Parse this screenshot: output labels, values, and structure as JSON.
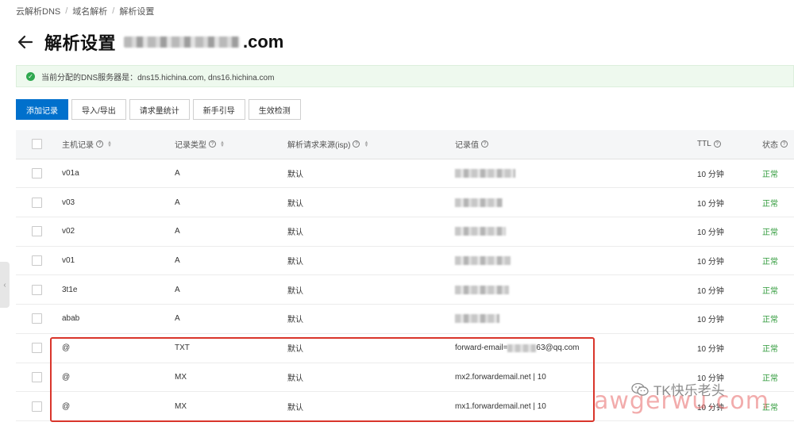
{
  "breadcrumb": [
    "云解析DNS",
    "域名解析",
    "解析设置"
  ],
  "title": {
    "text": "解析设置",
    "domain_suffix": ".com"
  },
  "notice": {
    "text": "当前分配的DNS服务器是：dns15.hichina.com, dns16.hichina.com"
  },
  "toolbar": {
    "add": "添加记录",
    "import_export": "导入/导出",
    "stats": "请求量统计",
    "guide": "新手引导",
    "check": "生效检测"
  },
  "columns": {
    "host": "主机记录",
    "type": "记录类型",
    "isp": "解析请求来源(isp)",
    "value": "记录值",
    "ttl": "TTL",
    "status": "状态"
  },
  "records": [
    {
      "host": "v01a",
      "type": "A",
      "isp": "默认",
      "value": "",
      "ttl": "10 分钟",
      "status": "正常"
    },
    {
      "host": "v03",
      "type": "A",
      "isp": "默认",
      "value": "",
      "ttl": "10 分钟",
      "status": "正常"
    },
    {
      "host": "v02",
      "type": "A",
      "isp": "默认",
      "value": "",
      "ttl": "10 分钟",
      "status": "正常"
    },
    {
      "host": "v01",
      "type": "A",
      "isp": "默认",
      "value": "",
      "ttl": "10 分钟",
      "status": "正常"
    },
    {
      "host": "3t1e",
      "type": "A",
      "isp": "默认",
      "value": "",
      "ttl": "10 分钟",
      "status": "正常"
    },
    {
      "host": "abab",
      "type": "A",
      "isp": "默认",
      "value": "",
      "ttl": "10 分钟",
      "status": "正常"
    },
    {
      "host": "@",
      "type": "TXT",
      "isp": "默认",
      "value_prefix": "forward-email=",
      "value_suffix": "63@qq.com",
      "ttl": "10 分钟",
      "status": "正常"
    },
    {
      "host": "@",
      "type": "MX",
      "isp": "默认",
      "value": "mx2.forwardemail.net | 10",
      "ttl": "10 分钟",
      "status": "正常"
    },
    {
      "host": "@",
      "type": "MX",
      "isp": "默认",
      "value": "mx1.forwardemail.net | 10",
      "ttl": "10 分钟",
      "status": "正常"
    }
  ],
  "watermark": {
    "account": "TK快乐老头",
    "site": "awgerwu.com"
  },
  "colors": {
    "primary": "#0070cc",
    "success": "#2f9a3a",
    "highlight": "#d9352b",
    "notice_bg": "#eef9ee"
  }
}
